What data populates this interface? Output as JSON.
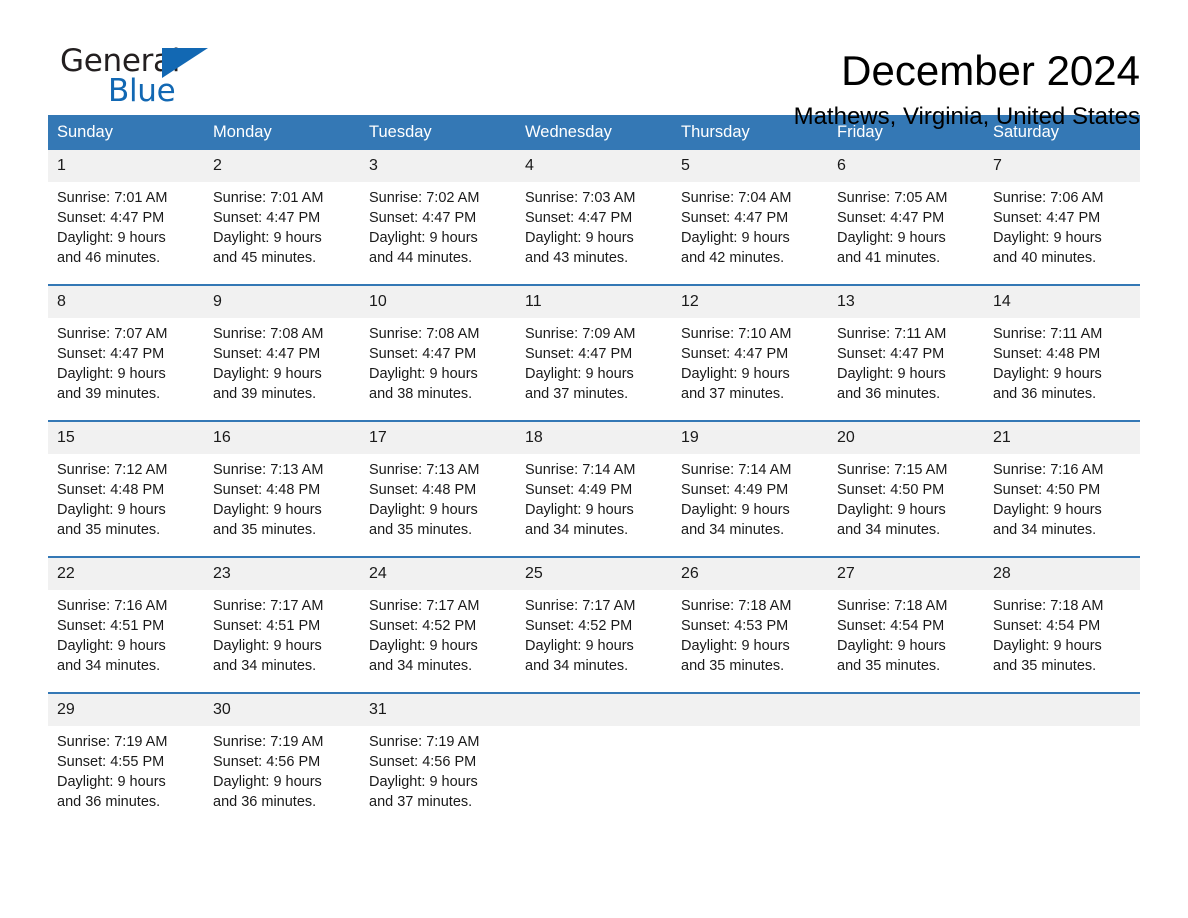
{
  "logo": {
    "word1": "General",
    "word2": "Blue",
    "triangle_color": "#1268b3"
  },
  "header": {
    "title": "December 2024",
    "subtitle": "Mathews, Virginia, United States"
  },
  "theme": {
    "header_blue": "#3478b5",
    "daynum_gray": "#f1f1f1",
    "text": "#1a1a1a"
  },
  "weekdays": [
    "Sunday",
    "Monday",
    "Tuesday",
    "Wednesday",
    "Thursday",
    "Friday",
    "Saturday"
  ],
  "weeks": [
    [
      {
        "day": "1",
        "sunrise": "Sunrise: 7:01 AM",
        "sunset": "Sunset: 4:47 PM",
        "daylight": "Daylight: 9 hours and 46 minutes."
      },
      {
        "day": "2",
        "sunrise": "Sunrise: 7:01 AM",
        "sunset": "Sunset: 4:47 PM",
        "daylight": "Daylight: 9 hours and 45 minutes."
      },
      {
        "day": "3",
        "sunrise": "Sunrise: 7:02 AM",
        "sunset": "Sunset: 4:47 PM",
        "daylight": "Daylight: 9 hours and 44 minutes."
      },
      {
        "day": "4",
        "sunrise": "Sunrise: 7:03 AM",
        "sunset": "Sunset: 4:47 PM",
        "daylight": "Daylight: 9 hours and 43 minutes."
      },
      {
        "day": "5",
        "sunrise": "Sunrise: 7:04 AM",
        "sunset": "Sunset: 4:47 PM",
        "daylight": "Daylight: 9 hours and 42 minutes."
      },
      {
        "day": "6",
        "sunrise": "Sunrise: 7:05 AM",
        "sunset": "Sunset: 4:47 PM",
        "daylight": "Daylight: 9 hours and 41 minutes."
      },
      {
        "day": "7",
        "sunrise": "Sunrise: 7:06 AM",
        "sunset": "Sunset: 4:47 PM",
        "daylight": "Daylight: 9 hours and 40 minutes."
      }
    ],
    [
      {
        "day": "8",
        "sunrise": "Sunrise: 7:07 AM",
        "sunset": "Sunset: 4:47 PM",
        "daylight": "Daylight: 9 hours and 39 minutes."
      },
      {
        "day": "9",
        "sunrise": "Sunrise: 7:08 AM",
        "sunset": "Sunset: 4:47 PM",
        "daylight": "Daylight: 9 hours and 39 minutes."
      },
      {
        "day": "10",
        "sunrise": "Sunrise: 7:08 AM",
        "sunset": "Sunset: 4:47 PM",
        "daylight": "Daylight: 9 hours and 38 minutes."
      },
      {
        "day": "11",
        "sunrise": "Sunrise: 7:09 AM",
        "sunset": "Sunset: 4:47 PM",
        "daylight": "Daylight: 9 hours and 37 minutes."
      },
      {
        "day": "12",
        "sunrise": "Sunrise: 7:10 AM",
        "sunset": "Sunset: 4:47 PM",
        "daylight": "Daylight: 9 hours and 37 minutes."
      },
      {
        "day": "13",
        "sunrise": "Sunrise: 7:11 AM",
        "sunset": "Sunset: 4:47 PM",
        "daylight": "Daylight: 9 hours and 36 minutes."
      },
      {
        "day": "14",
        "sunrise": "Sunrise: 7:11 AM",
        "sunset": "Sunset: 4:48 PM",
        "daylight": "Daylight: 9 hours and 36 minutes."
      }
    ],
    [
      {
        "day": "15",
        "sunrise": "Sunrise: 7:12 AM",
        "sunset": "Sunset: 4:48 PM",
        "daylight": "Daylight: 9 hours and 35 minutes."
      },
      {
        "day": "16",
        "sunrise": "Sunrise: 7:13 AM",
        "sunset": "Sunset: 4:48 PM",
        "daylight": "Daylight: 9 hours and 35 minutes."
      },
      {
        "day": "17",
        "sunrise": "Sunrise: 7:13 AM",
        "sunset": "Sunset: 4:48 PM",
        "daylight": "Daylight: 9 hours and 35 minutes."
      },
      {
        "day": "18",
        "sunrise": "Sunrise: 7:14 AM",
        "sunset": "Sunset: 4:49 PM",
        "daylight": "Daylight: 9 hours and 34 minutes."
      },
      {
        "day": "19",
        "sunrise": "Sunrise: 7:14 AM",
        "sunset": "Sunset: 4:49 PM",
        "daylight": "Daylight: 9 hours and 34 minutes."
      },
      {
        "day": "20",
        "sunrise": "Sunrise: 7:15 AM",
        "sunset": "Sunset: 4:50 PM",
        "daylight": "Daylight: 9 hours and 34 minutes."
      },
      {
        "day": "21",
        "sunrise": "Sunrise: 7:16 AM",
        "sunset": "Sunset: 4:50 PM",
        "daylight": "Daylight: 9 hours and 34 minutes."
      }
    ],
    [
      {
        "day": "22",
        "sunrise": "Sunrise: 7:16 AM",
        "sunset": "Sunset: 4:51 PM",
        "daylight": "Daylight: 9 hours and 34 minutes."
      },
      {
        "day": "23",
        "sunrise": "Sunrise: 7:17 AM",
        "sunset": "Sunset: 4:51 PM",
        "daylight": "Daylight: 9 hours and 34 minutes."
      },
      {
        "day": "24",
        "sunrise": "Sunrise: 7:17 AM",
        "sunset": "Sunset: 4:52 PM",
        "daylight": "Daylight: 9 hours and 34 minutes."
      },
      {
        "day": "25",
        "sunrise": "Sunrise: 7:17 AM",
        "sunset": "Sunset: 4:52 PM",
        "daylight": "Daylight: 9 hours and 34 minutes."
      },
      {
        "day": "26",
        "sunrise": "Sunrise: 7:18 AM",
        "sunset": "Sunset: 4:53 PM",
        "daylight": "Daylight: 9 hours and 35 minutes."
      },
      {
        "day": "27",
        "sunrise": "Sunrise: 7:18 AM",
        "sunset": "Sunset: 4:54 PM",
        "daylight": "Daylight: 9 hours and 35 minutes."
      },
      {
        "day": "28",
        "sunrise": "Sunrise: 7:18 AM",
        "sunset": "Sunset: 4:54 PM",
        "daylight": "Daylight: 9 hours and 35 minutes."
      }
    ],
    [
      {
        "day": "29",
        "sunrise": "Sunrise: 7:19 AM",
        "sunset": "Sunset: 4:55 PM",
        "daylight": "Daylight: 9 hours and 36 minutes."
      },
      {
        "day": "30",
        "sunrise": "Sunrise: 7:19 AM",
        "sunset": "Sunset: 4:56 PM",
        "daylight": "Daylight: 9 hours and 36 minutes."
      },
      {
        "day": "31",
        "sunrise": "Sunrise: 7:19 AM",
        "sunset": "Sunset: 4:56 PM",
        "daylight": "Daylight: 9 hours and 37 minutes."
      },
      {
        "day": "",
        "sunrise": "",
        "sunset": "",
        "daylight": ""
      },
      {
        "day": "",
        "sunrise": "",
        "sunset": "",
        "daylight": ""
      },
      {
        "day": "",
        "sunrise": "",
        "sunset": "",
        "daylight": ""
      },
      {
        "day": "",
        "sunrise": "",
        "sunset": "",
        "daylight": ""
      }
    ]
  ]
}
